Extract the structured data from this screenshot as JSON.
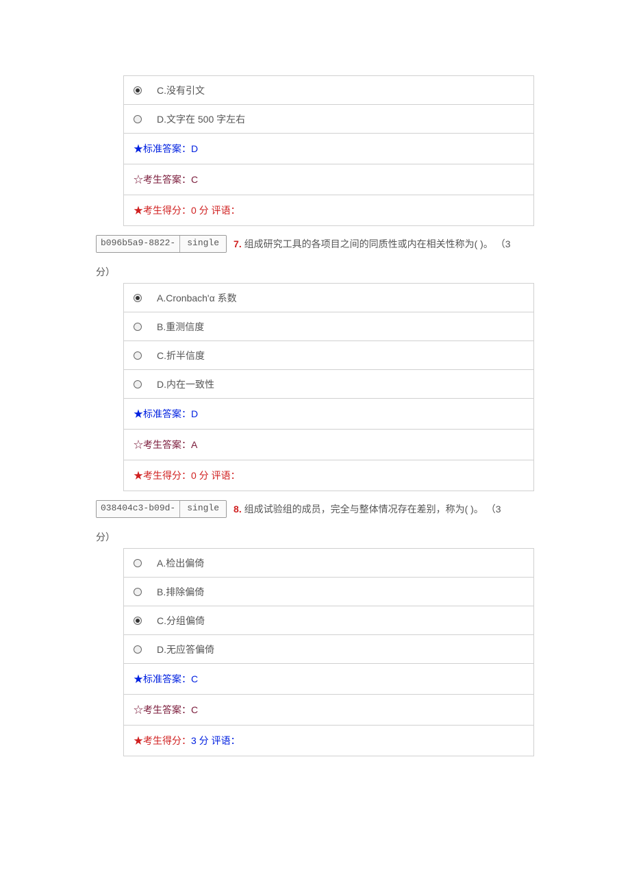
{
  "q6": {
    "options": [
      {
        "key": "C",
        "text": "C.没有引文",
        "selected": true
      },
      {
        "key": "D",
        "text": "D.文字在 500 字左右",
        "selected": false
      }
    ],
    "std_label": "★标准答案：D",
    "cand_label": "☆考生答案：C",
    "score_label": "★考生得分：0 分  评语："
  },
  "q7": {
    "id_left": "b096b5a9-8822-",
    "id_right": "single",
    "number": "7.",
    "text_main": "组成研究工具的各项目之间的同质性或内在相关性称为( )。 （3",
    "text_cont": "分）",
    "options": [
      {
        "key": "A",
        "text": "A.Cronbach'α 系数",
        "selected": true
      },
      {
        "key": "B",
        "text": "B.重测信度",
        "selected": false
      },
      {
        "key": "C",
        "text": "C.折半信度",
        "selected": false
      },
      {
        "key": "D",
        "text": "D.内在一致性",
        "selected": false
      }
    ],
    "std_label": "★标准答案：D",
    "cand_label": "☆考生答案：A",
    "score_label": "★考生得分：0 分  评语："
  },
  "q8": {
    "id_left": "038404c3-b09d-",
    "id_right": "single",
    "number": "8.",
    "text_main": "组成试验组的成员，完全与整体情况存在差别，称为( )。 （3",
    "text_cont": "分）",
    "options": [
      {
        "key": "A",
        "text": "A.检出偏倚",
        "selected": false
      },
      {
        "key": "B",
        "text": "B.排除偏倚",
        "selected": false
      },
      {
        "key": "C",
        "text": "C.分组偏倚",
        "selected": true
      },
      {
        "key": "D",
        "text": "D.无应答偏倚",
        "selected": false
      }
    ],
    "std_label": "★标准答案：C",
    "cand_label": "☆考生答案：C",
    "score_prefix": "★考生得分：",
    "score_value": "3 分  评语："
  }
}
